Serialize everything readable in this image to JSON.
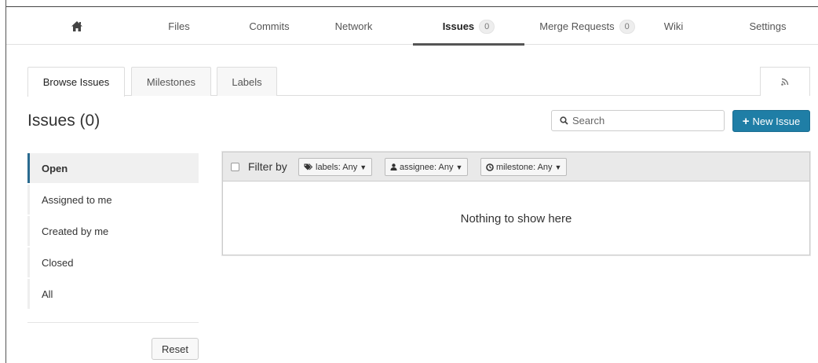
{
  "nav": {
    "home_icon": "home-icon",
    "items": [
      {
        "label": "Files"
      },
      {
        "label": "Commits"
      },
      {
        "label": "Network"
      },
      {
        "label": "Issues",
        "count": "0"
      },
      {
        "label": "Merge Requests",
        "count": "0"
      },
      {
        "label": "Wiki"
      },
      {
        "label": "Settings"
      }
    ]
  },
  "subtabs": {
    "browse": "Browse Issues",
    "milestones": "Milestones",
    "labels": "Labels",
    "rss_icon": "rss-icon",
    "rss_glyph": "))"
  },
  "page": {
    "title": "Issues (0)"
  },
  "search": {
    "placeholder": "Search",
    "icon_glyph": "⚲"
  },
  "new_issue": {
    "label": "New Issue",
    "plus": "+"
  },
  "sidebar": {
    "items": [
      {
        "label": "Open"
      },
      {
        "label": "Assigned to me"
      },
      {
        "label": "Created by me"
      },
      {
        "label": "Closed"
      },
      {
        "label": "All"
      }
    ],
    "reset_label": "Reset"
  },
  "filters": {
    "label": "Filter by",
    "labels_btn": "labels: Any",
    "assignee_btn": "assignee: Any",
    "milestone_btn": "milestone: Any"
  },
  "empty_message": "Nothing to show here",
  "colors": {
    "primary": "#1f7ea6",
    "active_border": "#2a6a8f"
  }
}
